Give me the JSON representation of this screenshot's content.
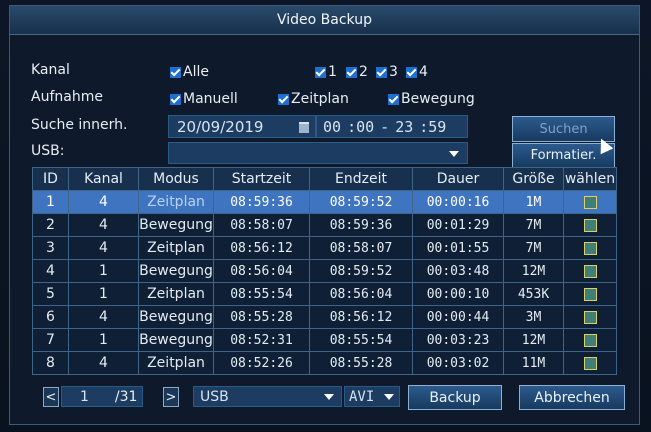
{
  "window": {
    "title": "Video Backup"
  },
  "filters": {
    "kanal_label": "Kanal",
    "kanal_all": "Alle",
    "channels": [
      "1",
      "2",
      "3",
      "4"
    ],
    "aufnahme_label": "Aufnahme",
    "aufnahme_options": [
      "Manuell",
      "Zeitplan",
      "Bewegung"
    ],
    "suche_label": "Suche innerh.",
    "date": "20/09/2019",
    "time_from_h": "00",
    "time_from_m": ":00",
    "time_sep": "-",
    "time_to_h": "23",
    "time_to_m": ":59",
    "usb_label": "USB:",
    "usb_value": "",
    "search_button": "Suchen",
    "format_button": "Formatier."
  },
  "table": {
    "headers": [
      "ID",
      "Kanal",
      "Modus",
      "Startzeit",
      "Endzeit",
      "Dauer",
      "Größe",
      "wählen"
    ],
    "rows": [
      [
        "1",
        "4",
        "Zeitplan",
        "08:59:36",
        "08:59:52",
        "00:00:16",
        "1M"
      ],
      [
        "2",
        "4",
        "Bewegung",
        "08:58:07",
        "08:59:36",
        "00:01:29",
        "7M"
      ],
      [
        "3",
        "4",
        "Zeitplan",
        "08:56:12",
        "08:58:07",
        "00:01:55",
        "7M"
      ],
      [
        "4",
        "1",
        "Bewegung",
        "08:56:04",
        "08:59:52",
        "00:03:48",
        "12M"
      ],
      [
        "5",
        "1",
        "Zeitplan",
        "08:55:54",
        "08:56:04",
        "00:00:10",
        "453K"
      ],
      [
        "6",
        "4",
        "Bewegung",
        "08:55:28",
        "08:56:12",
        "00:00:44",
        "3M"
      ],
      [
        "7",
        "1",
        "Bewegung",
        "08:52:31",
        "08:55:54",
        "00:03:23",
        "12M"
      ],
      [
        "8",
        "4",
        "Zeitplan",
        "08:52:26",
        "08:55:28",
        "00:03:02",
        "11M"
      ]
    ],
    "selected_row": 0
  },
  "footer": {
    "prev": "<",
    "page": "1",
    "total": "/31",
    "next": ">",
    "device": "USB",
    "format": "AVI",
    "backup_button": "Backup",
    "cancel_button": "Abbrechen"
  },
  "colors": {
    "accent": "#1f6fd0",
    "selected_row": "#3f74c0",
    "title_bar": "#2a4a6c"
  },
  "icons": {
    "check": "checkbox-checked-icon",
    "calendar": "calendar-icon",
    "dropdown": "chevron-down-icon",
    "cursor": "mouse-pointer-icon"
  }
}
